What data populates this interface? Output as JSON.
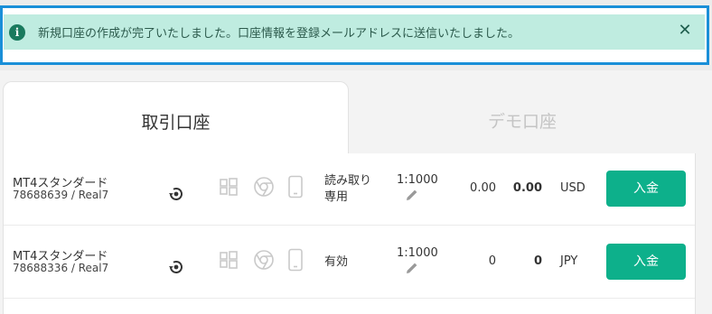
{
  "notification": {
    "message": "新規口座の作成が完了いたしました。口座情報を登録メールアドレスに送信いたしました。",
    "info_icon": "i",
    "close_icon": "✕"
  },
  "tabs": [
    {
      "label": "取引口座",
      "active": true
    },
    {
      "label": "デモ口座",
      "active": false
    }
  ],
  "accounts": [
    {
      "name": "MT4スタンダード",
      "id": "78688639 / Real7",
      "status": "読み取り専用",
      "leverage": "1:1000",
      "balance": "0.00",
      "equity": "0.00",
      "currency": "USD",
      "deposit_label": "入金"
    },
    {
      "name": "MT4スタンダード",
      "id": "78688336 / Real7",
      "status": "有効",
      "leverage": "1:1000",
      "balance": "0",
      "equity": "0",
      "currency": "JPY",
      "deposit_label": "入金"
    }
  ],
  "colors": {
    "accent": "#0db08b",
    "notification_bg": "#bfece0",
    "highlight_border": "#1a8fd8"
  }
}
